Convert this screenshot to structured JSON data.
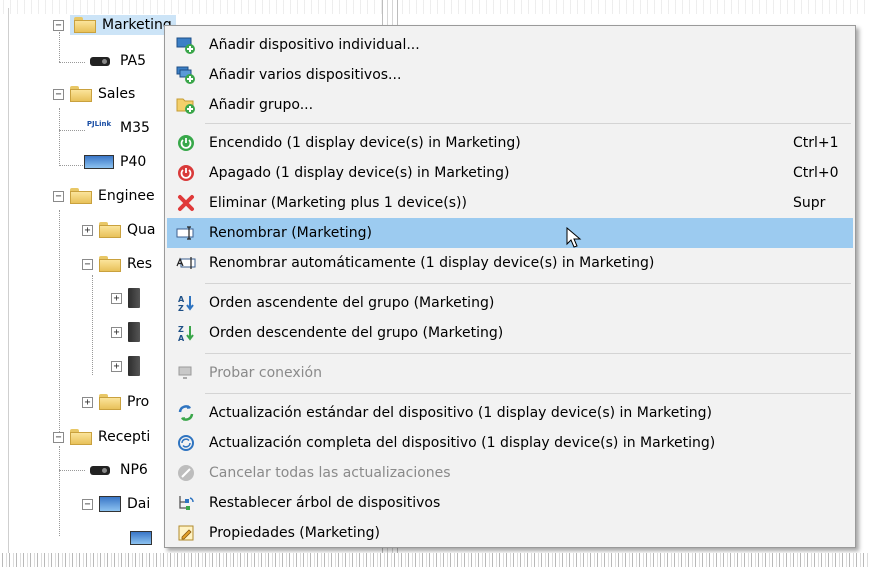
{
  "tree": {
    "items": [
      {
        "label": "Marketing",
        "expander": "−",
        "kind": "folder",
        "selected": true
      },
      {
        "label": "PA5",
        "kind": "projector"
      },
      {
        "label": "Sales",
        "expander": "−",
        "kind": "folder"
      },
      {
        "label": "M35",
        "kind": "pjlink",
        "badge": "PJLink"
      },
      {
        "label": "P40",
        "kind": "display"
      },
      {
        "label": "Enginee",
        "expander": "−",
        "kind": "folder"
      },
      {
        "label": "Qua",
        "expander": "+",
        "kind": "folder"
      },
      {
        "label": "Res",
        "expander": "−",
        "kind": "folder"
      },
      {
        "label": "",
        "expander": "+",
        "kind": "tower"
      },
      {
        "label": "",
        "expander": "+",
        "kind": "tower"
      },
      {
        "label": "",
        "expander": "+",
        "kind": "tower"
      },
      {
        "label": "Pro",
        "expander": "+",
        "kind": "folder"
      },
      {
        "label": "Recepti",
        "expander": "−",
        "kind": "folder"
      },
      {
        "label": "NP6",
        "kind": "projector"
      },
      {
        "label": "Dai",
        "expander": "−",
        "kind": "display"
      },
      {
        "label": "",
        "kind": "display"
      }
    ]
  },
  "context_menu": {
    "items": [
      {
        "label": "Añadir dispositivo individual...",
        "icon": "add-device-icon",
        "shortcut": "",
        "enabled": true
      },
      {
        "label": "Añadir varios dispositivos...",
        "icon": "add-multiple-devices-icon",
        "shortcut": "",
        "enabled": true
      },
      {
        "label": "Añadir grupo...",
        "icon": "add-group-icon",
        "shortcut": "",
        "enabled": true
      },
      {
        "label": "Encendido  (1 display device(s) in Marketing)",
        "icon": "power-on-icon",
        "shortcut": "Ctrl+1",
        "enabled": true
      },
      {
        "label": "Apagado  (1 display device(s) in Marketing)",
        "icon": "power-off-icon",
        "shortcut": "Ctrl+0",
        "enabled": true
      },
      {
        "label": "Eliminar  (Marketing plus 1 device(s))",
        "icon": "delete-icon",
        "shortcut": "Supr",
        "enabled": true
      },
      {
        "label": "Renombrar  (Marketing)",
        "icon": "rename-icon",
        "shortcut": "",
        "enabled": true,
        "highlighted": true
      },
      {
        "label": "Renombrar automáticamente  (1 display device(s) in Marketing)",
        "icon": "auto-rename-icon",
        "shortcut": "",
        "enabled": true
      },
      {
        "label": "Orden ascendente del grupo  (Marketing)",
        "icon": "sort-ascending-icon",
        "shortcut": "",
        "enabled": true
      },
      {
        "label": "Orden descendente del grupo  (Marketing)",
        "icon": "sort-descending-icon",
        "shortcut": "",
        "enabled": true
      },
      {
        "label": "Probar conexión",
        "icon": "test-connection-icon",
        "shortcut": "",
        "enabled": false
      },
      {
        "label": "Actualización estándar del dispositivo  (1 display device(s) in Marketing)",
        "icon": "standard-update-icon",
        "shortcut": "",
        "enabled": true
      },
      {
        "label": "Actualización completa del dispositivo  (1 display device(s) in Marketing)",
        "icon": "full-update-icon",
        "shortcut": "",
        "enabled": true
      },
      {
        "label": "Cancelar todas las actualizaciones",
        "icon": "cancel-updates-icon",
        "shortcut": "",
        "enabled": false
      },
      {
        "label": "Restablecer árbol de dispositivos",
        "icon": "reset-tree-icon",
        "shortcut": "",
        "enabled": true
      },
      {
        "label": "Propiedades  (Marketing)",
        "icon": "properties-icon",
        "shortcut": "",
        "enabled": true
      }
    ]
  },
  "colors": {
    "highlight": "#9ccbf0",
    "selection": "#cce4f7",
    "menu_bg": "#f2f2f2",
    "disabled_text": "#8a8a8a"
  }
}
